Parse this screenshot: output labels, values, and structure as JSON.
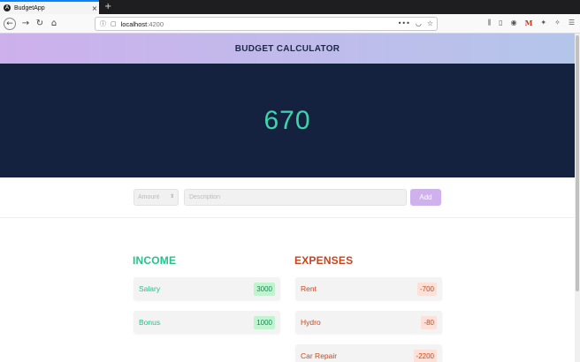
{
  "browser": {
    "tab_title": "BudgetApp",
    "url_host": "localhost",
    "url_port": ":4200"
  },
  "header": {
    "title": "BUDGET CALCULATOR"
  },
  "summary": {
    "total": "670"
  },
  "form": {
    "amount_placeholder": "Amount",
    "description_placeholder": "Description",
    "add_label": "Add"
  },
  "income": {
    "title": "INCOME",
    "items": [
      {
        "name": "Salary",
        "amount": "3000"
      },
      {
        "name": "Bonus",
        "amount": "1000"
      }
    ]
  },
  "expenses": {
    "title": "EXPENSES",
    "items": [
      {
        "name": "Rent",
        "amount": "-700"
      },
      {
        "name": "Hydro",
        "amount": "-80"
      },
      {
        "name": "Car Repair",
        "amount": "-2200"
      }
    ]
  },
  "colors": {
    "header_gradient_start": "#cdb0ec",
    "header_gradient_end": "#b4c5ea",
    "hero_bg": "#14213f",
    "total_text": "#3fd4ae",
    "income": "#22c487",
    "expense": "#c8431a",
    "add_button": "#cfb2ec"
  }
}
